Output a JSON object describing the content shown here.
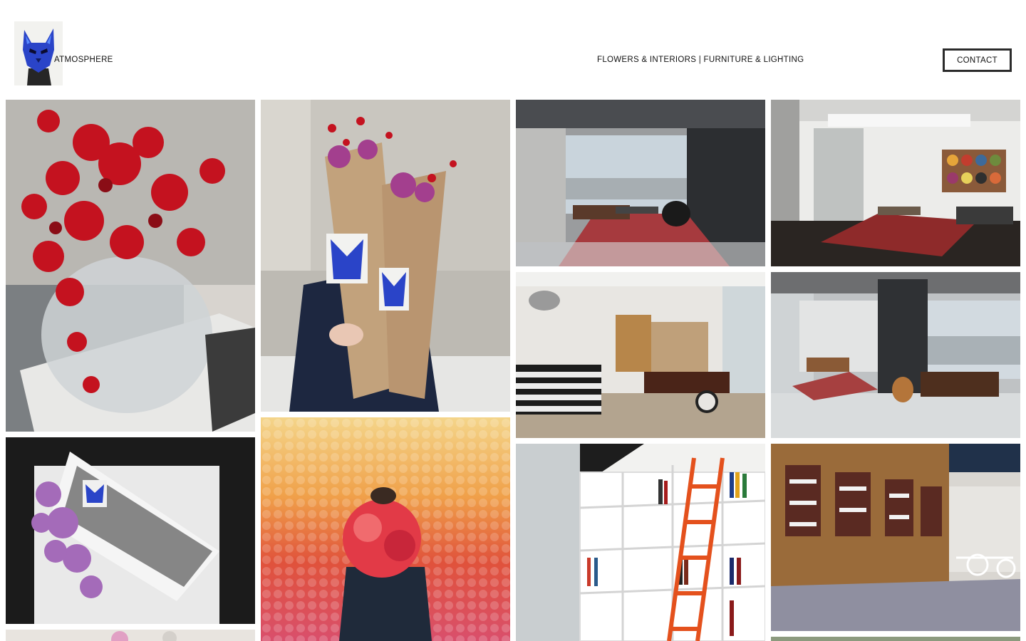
{
  "header": {
    "brand": "ATMOSPHERE",
    "tagline": "FLOWERS & INTERIORS | FURNITURE & LIGHTING",
    "contact_label": "CONTACT"
  },
  "logo": {
    "icon": "blue-cat-icon"
  },
  "gallery": {
    "photos": [
      {
        "subject": "red-berries-vase-photo"
      },
      {
        "subject": "bouquets-with-cat-stickers-photo"
      },
      {
        "subject": "loft-living-room-photo"
      },
      {
        "subject": "living-room-with-art-photo"
      },
      {
        "subject": "office-with-striped-sofa-photo"
      },
      {
        "subject": "loft-office-photo"
      },
      {
        "subject": "lilac-bouquet-triangle-wrap-photo"
      },
      {
        "subject": "rose-wall-photo"
      },
      {
        "subject": "bookshelves-with-ladder-photo"
      },
      {
        "subject": "restaurant-cabinet-photo"
      },
      {
        "subject": "table-setting-photo"
      },
      {
        "subject": "interior-photo"
      }
    ]
  },
  "colors": {
    "berry_red": "#c4121f",
    "cat_blue": "#2a44c8",
    "kraft": "#c2a27c",
    "button_border": "#2b2b2b"
  }
}
